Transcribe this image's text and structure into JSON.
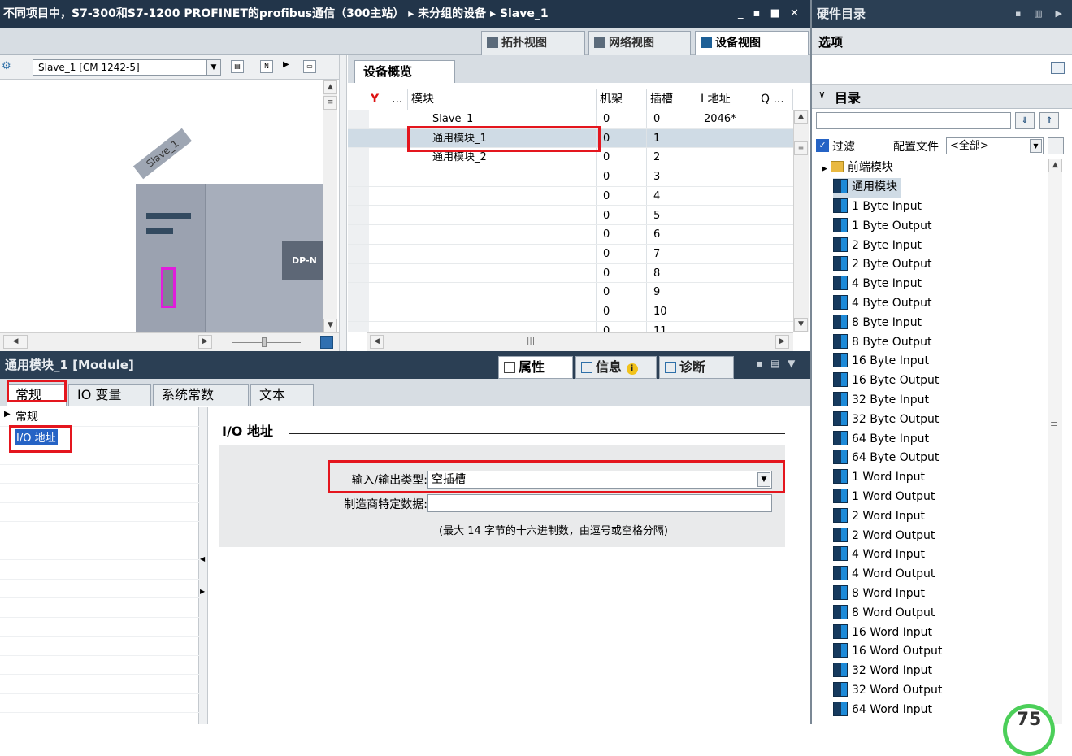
{
  "window": {
    "breadcrumb": "不同项目中，S7-300和S7-1200 PROFINET的profibus通信（300主站） ▸ 未分组的设备 ▸ Slave_1",
    "controls": "_ ▪ ■ ✕"
  },
  "view_tabs": {
    "topology": "拓扑视图",
    "network": "网络视图",
    "device": "设备视图"
  },
  "device_dropdown": {
    "value": "Slave_1 [CM 1242-5]"
  },
  "canvas": {
    "device_label": "Slave_1",
    "module_label": "DP-N"
  },
  "overview": {
    "tab": "设备概览",
    "headers": {
      "flag": "...",
      "module": "模块",
      "rack": "机架",
      "slot": "插槽",
      "iaddr": "I 地址",
      "qaddr": "Q ..."
    },
    "rows": [
      {
        "module": "Slave_1",
        "rack": "0",
        "slot": "0",
        "iaddr": "2046*"
      },
      {
        "module": "通用模块_1",
        "rack": "0",
        "slot": "1",
        "iaddr": ""
      },
      {
        "module": "通用模块_2",
        "rack": "0",
        "slot": "2",
        "iaddr": ""
      },
      {
        "module": "",
        "rack": "0",
        "slot": "3",
        "iaddr": ""
      },
      {
        "module": "",
        "rack": "0",
        "slot": "4",
        "iaddr": ""
      },
      {
        "module": "",
        "rack": "0",
        "slot": "5",
        "iaddr": ""
      },
      {
        "module": "",
        "rack": "0",
        "slot": "6",
        "iaddr": ""
      },
      {
        "module": "",
        "rack": "0",
        "slot": "7",
        "iaddr": ""
      },
      {
        "module": "",
        "rack": "0",
        "slot": "8",
        "iaddr": ""
      },
      {
        "module": "",
        "rack": "0",
        "slot": "9",
        "iaddr": ""
      },
      {
        "module": "",
        "rack": "0",
        "slot": "10",
        "iaddr": ""
      },
      {
        "module": "",
        "rack": "0",
        "slot": "11",
        "iaddr": ""
      }
    ]
  },
  "properties": {
    "title": "通用模块_1 [Module]",
    "tab_properties": "属性",
    "tab_info": "信息",
    "tab_diagnostics": "诊断",
    "subtabs": [
      "常规",
      "IO 变量",
      "系统常数",
      "文本"
    ],
    "nav": {
      "general": "常规",
      "io_address": "I/O 地址"
    },
    "section_title": "I/O 地址",
    "io_type_label": "输入/输出类型:",
    "io_type_value": "空插槽",
    "vendor_label": "制造商特定数据:",
    "vendor_value": "",
    "hint": "(最大 14 字节的十六进制数，由逗号或空格分隔)"
  },
  "catalog": {
    "title": "硬件目录",
    "options": "选项",
    "section": "目录",
    "search_value": "",
    "filter_label": "过滤",
    "profile_label": "配置文件",
    "profile_value": "<全部>",
    "folder": "前端模块",
    "group": "通用模块",
    "items": [
      "1 Byte Input",
      "1 Byte Output",
      "2 Byte Input",
      "2 Byte Output",
      "4 Byte Input",
      "4 Byte Output",
      "8 Byte Input",
      "8 Byte Output",
      "16 Byte Input",
      "16 Byte Output",
      "32 Byte Input",
      "32 Byte Output",
      "64 Byte Input",
      "64 Byte Output",
      "1 Word Input",
      "1 Word Output",
      "2 Word Input",
      "2 Word Output",
      "4 Word Input",
      "4 Word Output",
      "8 Word Input",
      "8 Word Output",
      "16 Word Input",
      "16 Word Output",
      "32 Word Input",
      "32 Word Output",
      "64 Word Input"
    ]
  },
  "progress": {
    "value": "75"
  }
}
